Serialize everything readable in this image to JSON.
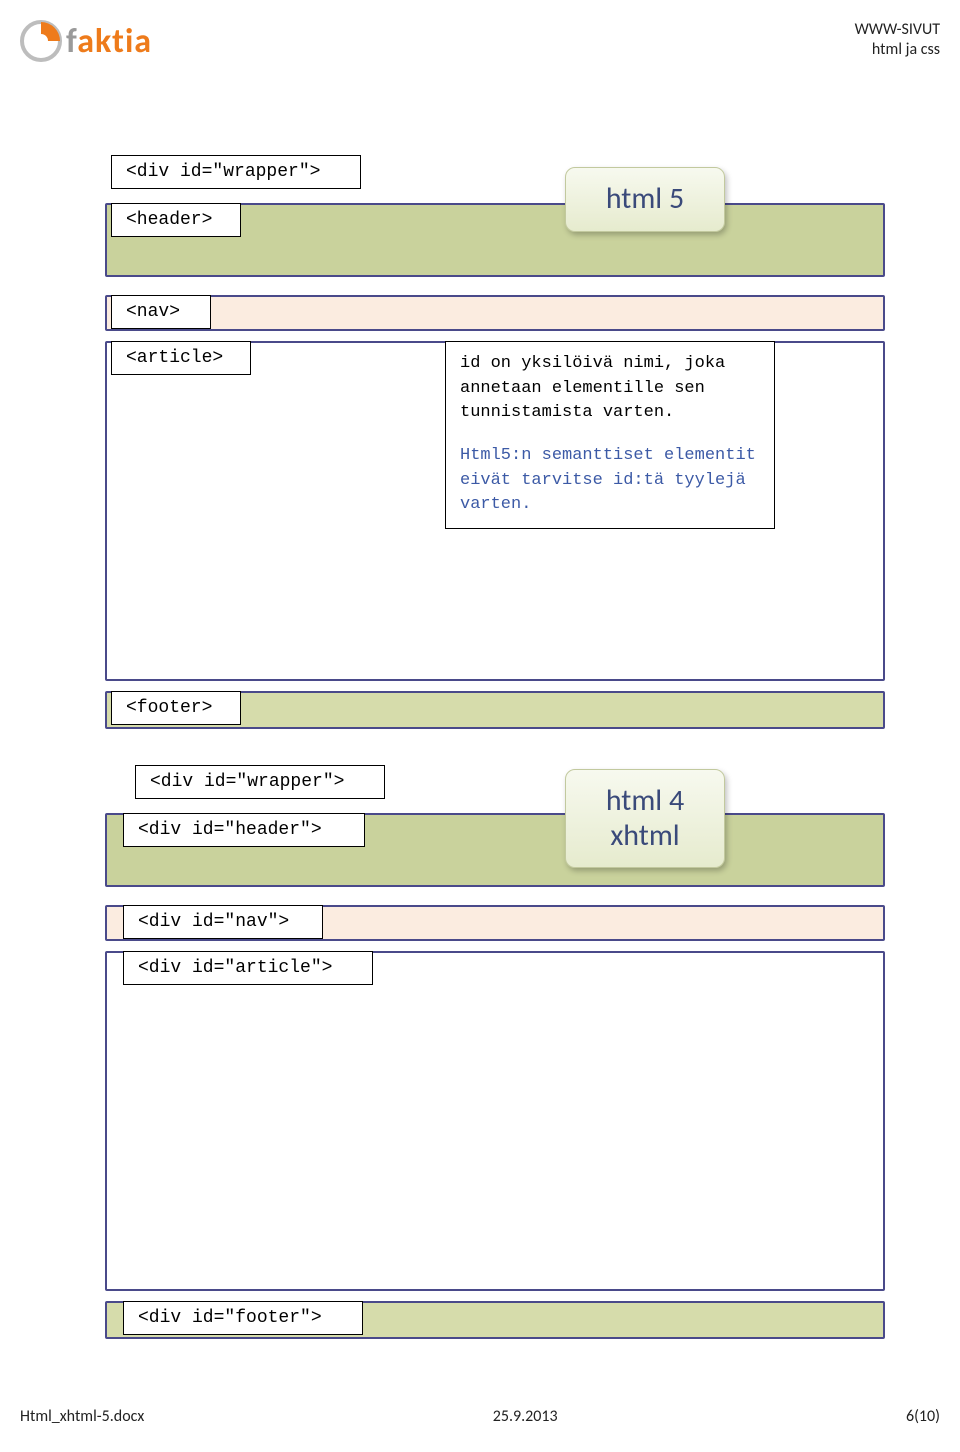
{
  "header": {
    "logo_text_1": "f",
    "logo_text_2": "aktia",
    "right_line1": "WWW-SIVUT",
    "right_line2": "html ja css"
  },
  "diagram1": {
    "wrapper_tag": "<div id=\"wrapper\">",
    "header_tag": "<header>",
    "badge": "html 5",
    "nav_tag": "<nav>",
    "article_tag": "<article>",
    "info_p1": "id on yksilöivä nimi, joka annetaan elementille sen tunnistamista varten.",
    "info_p2": "Html5:n semanttiset elementit eivät tarvitse id:tä tyylejä varten.",
    "footer_tag": "<footer>"
  },
  "diagram2": {
    "wrapper_tag": "<div id=\"wrapper\">",
    "header_tag": "<div id=\"header\">",
    "badge_l1": "html 4",
    "badge_l2": "xhtml",
    "nav_tag": "<div id=\"nav\">",
    "article_tag": "<div id=\"article\">",
    "footer_tag": "<div id=\"footer\">"
  },
  "footer": {
    "left": "Html_xhtml-5.docx",
    "center": "25.9.2013",
    "right": "6(10)"
  }
}
